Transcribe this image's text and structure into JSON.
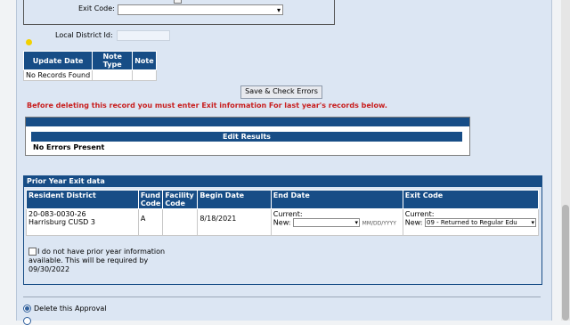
{
  "form": {
    "exit_code_label": "Exit Code:",
    "exit_code_value": "",
    "local_district_id_label": "Local District Id:",
    "local_district_id_value": ""
  },
  "update_table": {
    "headers": [
      "Update Date",
      "Note Type",
      "Note"
    ],
    "empty_text": "No Records Found"
  },
  "buttons": {
    "save_check": "Save & Check Errors"
  },
  "warning": "Before deleting this record you must enter Exit information For last year's records below.",
  "edit_results": {
    "title": "Edit Results",
    "message": "No Errors Present"
  },
  "prior_year": {
    "section_title": "Prior Year Exit data",
    "columns": {
      "resident_district": "Resident District",
      "fund_code": "Fund Code",
      "facility_code": "Facility Code",
      "begin_date": "Begin Date",
      "end_date": "End Date",
      "exit_code": "Exit Code"
    },
    "row": {
      "district_id": "20-083-0030-26",
      "district_name": "Harrisburg CUSD 3",
      "fund_code": "A",
      "facility_code": "",
      "begin_date": "8/18/2021",
      "end_current_label": "Current:",
      "end_new_label": "New:",
      "end_date_format": "MM/DD/YYYY",
      "exit_current_label": "Current:",
      "exit_new_label": "New:",
      "exit_new_value": "09 - Returned to Regular Edu"
    },
    "no_prior_info": "I do not have prior year information available. This will be required by 09/30/2022"
  },
  "actions": {
    "delete_approval_label": "Delete this Approval",
    "delete_approval_checked": true
  },
  "colors": {
    "header_blue": "#174d86",
    "warning_red": "#c81e1e",
    "panel_bg": "#dce6f3"
  }
}
